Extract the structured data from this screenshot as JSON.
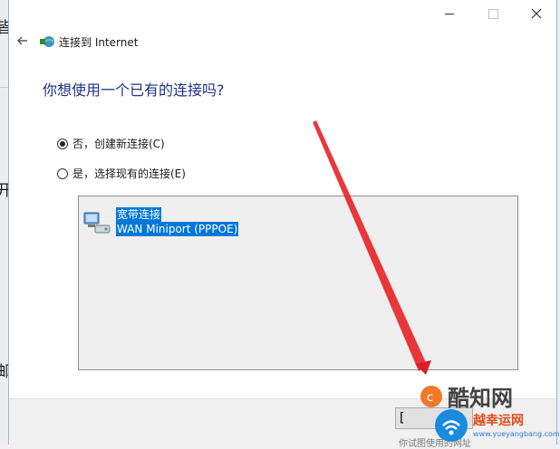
{
  "background": {
    "glyphs": [
      "皆",
      "开",
      "邮"
    ],
    "bottom_text": "你试图使用的网址"
  },
  "dialog": {
    "title": "连接到 Internet",
    "question": "你想使用一个已有的连接吗?",
    "options": [
      {
        "label": "否，创建新连接(C)",
        "selected": true
      },
      {
        "label": "是，选择现有的连接(E)",
        "selected": false
      }
    ],
    "connection": {
      "name": "宽带连接",
      "device": "WAN Miniport (PPPOE)",
      "icon": "network-icon"
    },
    "footer_button_label": "["
  },
  "watermarks": {
    "logo_text": "酷知网",
    "site_name": "越幸运网",
    "site_url": "www.yueyangbang.com"
  },
  "colors": {
    "heading": "#1e3287",
    "selection": "#0078d7",
    "arrow": "#e8262a"
  }
}
